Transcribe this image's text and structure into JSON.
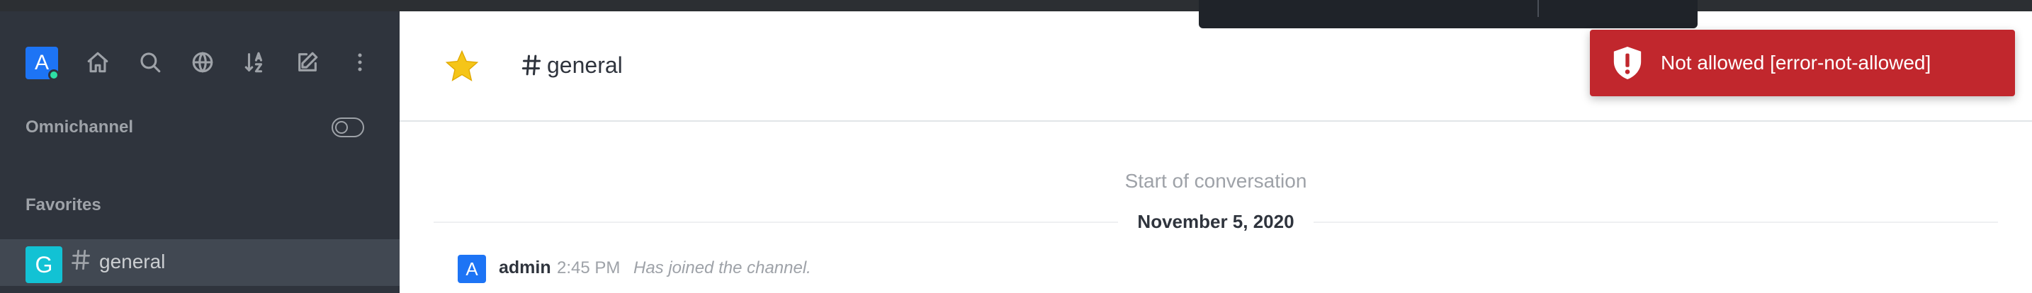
{
  "sidebar": {
    "user_avatar_letter": "A",
    "icons": [
      "home-icon",
      "search-icon",
      "directory-icon",
      "sort-icon",
      "create-new-icon",
      "kebab-menu-icon"
    ],
    "omnichannel_label": "Omnichannel",
    "favorites_label": "Favorites",
    "rooms": [
      {
        "avatar_letter": "G",
        "name": "general",
        "icon": "hashtag-icon",
        "selected": true
      }
    ]
  },
  "header": {
    "favorite_icon": "star-icon",
    "channel_icon": "hashtag-icon",
    "channel_name": "general"
  },
  "conversation": {
    "start_label": "Start of conversation",
    "date_divider": "November 5, 2020",
    "messages": [
      {
        "avatar_letter": "A",
        "user": "admin",
        "time": "2:45 PM",
        "text": "Has joined the channel."
      }
    ]
  },
  "toast": {
    "icon": "shield-alert-icon",
    "message": "Not allowed [error-not-allowed]"
  },
  "colors": {
    "sidebar_bg": "#2f343d",
    "selected_room_bg": "#414852",
    "accent_blue": "#1d74f5",
    "online_status": "#2de0a5",
    "room_avatar": "#12c2d4",
    "error_red": "#c1272d",
    "favorite_star": "#f5c518"
  }
}
